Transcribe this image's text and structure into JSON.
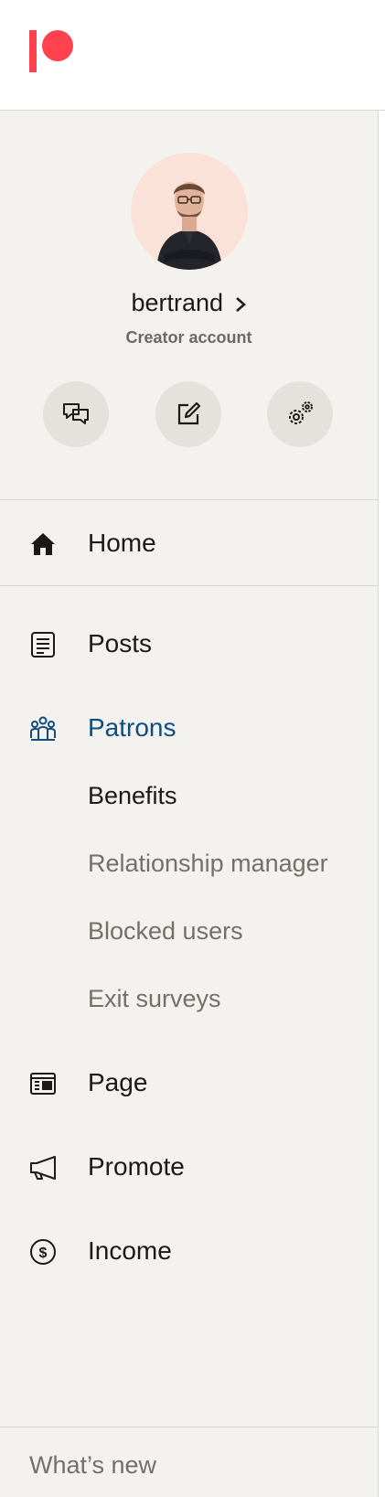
{
  "brand": {
    "color": "#ff424d",
    "accent": "#0f4c81"
  },
  "profile": {
    "username": "bertrand",
    "account_type": "Creator account",
    "actions": [
      {
        "icon": "chat-bubbles-icon"
      },
      {
        "icon": "edit-icon"
      },
      {
        "icon": "settings-gears-icon"
      }
    ]
  },
  "nav": {
    "home": "Home",
    "posts": "Posts",
    "patrons": "Patrons",
    "patrons_sub": [
      "Benefits",
      "Relationship manager",
      "Blocked users",
      "Exit surveys"
    ],
    "page": "Page",
    "promote": "Promote",
    "income": "Income"
  },
  "footer": {
    "whats_new": "What’s new"
  }
}
